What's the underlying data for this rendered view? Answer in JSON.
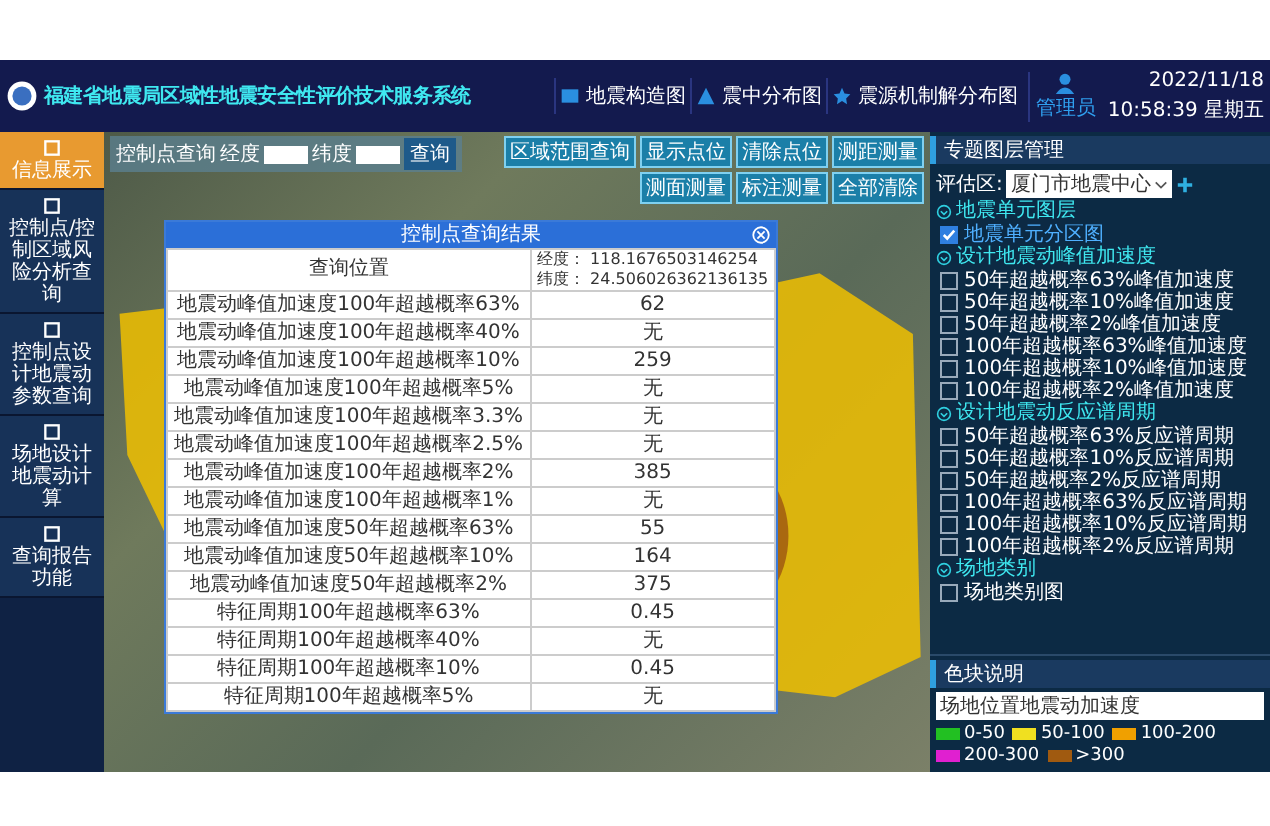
{
  "header": {
    "title": "福建省地震局区域性地震安全性评价技术服务系统",
    "nav": [
      {
        "label": "地震构造图"
      },
      {
        "label": "震中分布图"
      },
      {
        "label": "震源机制解分布图"
      }
    ],
    "user": "管理员",
    "date": "2022/11/18",
    "time": "10:58:39 星期五"
  },
  "sidebar": {
    "items": [
      {
        "label": "信息展示",
        "selected": true
      },
      {
        "label": "控制点/控制区域风险分析查询",
        "selected": false
      },
      {
        "label": "控制点设计地震动参数查询",
        "selected": false
      },
      {
        "label": "场地设计地震动计算",
        "selected": false
      },
      {
        "label": "查询报告功能",
        "selected": false
      }
    ]
  },
  "map": {
    "query": {
      "label": "控制点查询",
      "lon_label": "经度",
      "lat_label": "纬度",
      "button": "查询"
    },
    "tools": [
      "区域范围查询",
      "显示点位",
      "清除点位",
      "测距测量",
      "测面测量",
      "标注测量",
      "全部清除"
    ],
    "popup": {
      "title": "控制点查询结果",
      "location_label": "查询位置",
      "lon": "经度： 118.1676503146254",
      "lat": "纬度： 24.506026362136135",
      "rows": [
        {
          "name": "地震动峰值加速度100年超越概率63%",
          "value": "62"
        },
        {
          "name": "地震动峰值加速度100年超越概率40%",
          "value": "无"
        },
        {
          "name": "地震动峰值加速度100年超越概率10%",
          "value": "259"
        },
        {
          "name": "地震动峰值加速度100年超越概率5%",
          "value": "无"
        },
        {
          "name": "地震动峰值加速度100年超越概率3.3%",
          "value": "无"
        },
        {
          "name": "地震动峰值加速度100年超越概率2.5%",
          "value": "无"
        },
        {
          "name": "地震动峰值加速度100年超越概率2%",
          "value": "385"
        },
        {
          "name": "地震动峰值加速度100年超越概率1%",
          "value": "无"
        },
        {
          "name": "地震动峰值加速度50年超越概率63%",
          "value": "55"
        },
        {
          "name": "地震动峰值加速度50年超越概率10%",
          "value": "164"
        },
        {
          "name": "地震动峰值加速度50年超越概率2%",
          "value": "375"
        },
        {
          "name": "特征周期100年超越概率63%",
          "value": "0.45"
        },
        {
          "name": "特征周期100年超越概率40%",
          "value": "无"
        },
        {
          "name": "特征周期100年超越概率10%",
          "value": "0.45"
        },
        {
          "name": "特征周期100年超越概率5%",
          "value": "无"
        }
      ]
    }
  },
  "layers": {
    "title": "专题图层管理",
    "area_label": "评估区:",
    "area_value": "厦门市地震中心",
    "groups": [
      {
        "title": "地震单元图层",
        "items": [
          {
            "label": "地震单元分区图",
            "checked": true
          }
        ]
      },
      {
        "title": "设计地震动峰值加速度",
        "items": [
          {
            "label": "50年超越概率63%峰值加速度",
            "checked": false
          },
          {
            "label": "50年超越概率10%峰值加速度",
            "checked": false
          },
          {
            "label": "50年超越概率2%峰值加速度",
            "checked": false
          },
          {
            "label": "100年超越概率63%峰值加速度",
            "checked": false
          },
          {
            "label": "100年超越概率10%峰值加速度",
            "checked": false
          },
          {
            "label": "100年超越概率2%峰值加速度",
            "checked": false
          }
        ]
      },
      {
        "title": "设计地震动反应谱周期",
        "items": [
          {
            "label": "50年超越概率63%反应谱周期",
            "checked": false
          },
          {
            "label": "50年超越概率10%反应谱周期",
            "checked": false
          },
          {
            "label": "50年超越概率2%反应谱周期",
            "checked": false
          },
          {
            "label": "100年超越概率63%反应谱周期",
            "checked": false
          },
          {
            "label": "100年超越概率10%反应谱周期",
            "checked": false
          },
          {
            "label": "100年超越概率2%反应谱周期",
            "checked": false
          }
        ]
      },
      {
        "title": "场地类别",
        "items": [
          {
            "label": "场地类别图",
            "checked": false
          }
        ]
      }
    ]
  },
  "legend": {
    "title": "色块说明",
    "select": "场地位置地震动加速度",
    "items": [
      {
        "label": "0-50",
        "color": "#22c022"
      },
      {
        "label": "50-100",
        "color": "#f0e020"
      },
      {
        "label": "100-200",
        "color": "#f0a000"
      },
      {
        "label": "200-300",
        "color": "#e020d0"
      },
      {
        "label": ">300",
        "color": "#a05a10"
      }
    ]
  }
}
